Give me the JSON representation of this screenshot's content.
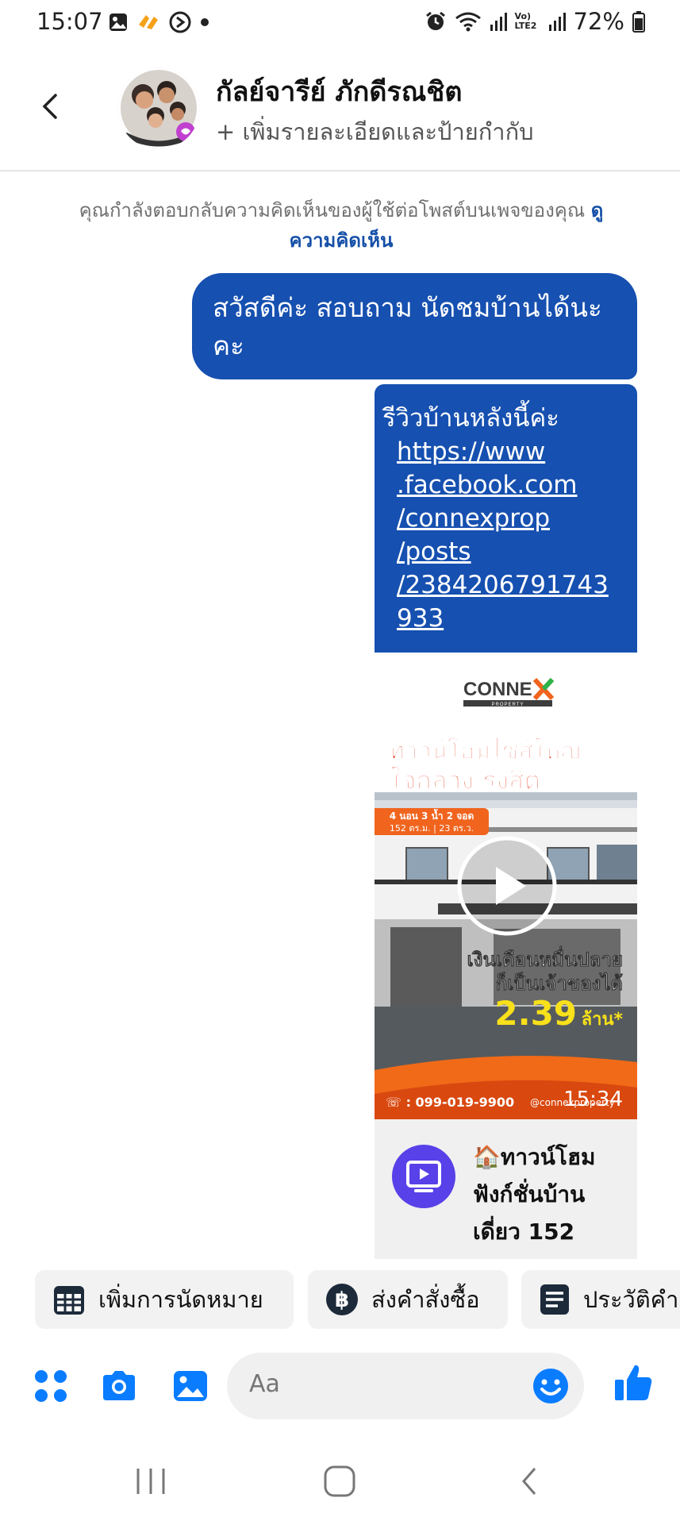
{
  "status_bar": {
    "time": "15:07",
    "left_icons": [
      "gallery-icon",
      "app-icon",
      "clock-icon",
      "dot-icon"
    ],
    "right_icons": [
      "alarm-icon",
      "wifi-icon",
      "signal-icon",
      "volte-icon",
      "signal-icon",
      "battery-icon"
    ],
    "volte_label": "Vo) LTE2",
    "battery": "72%"
  },
  "header": {
    "contact_name": "กัลย์จารีย์ ภักดีรณชิต",
    "contact_subtitle": "+ เพิ่มรายละเอียดและป้ายกำกับ"
  },
  "notice": {
    "text": "คุณกำลังตอบกลับความคิดเห็นของผู้ใช้ต่อโพสต์บนเพจของคุณ",
    "link": "ดูความคิดเห็น"
  },
  "messages": [
    {
      "text": "สวัสดีค่ะ สอบถาม นัดชมบ้านได้นะคะ"
    },
    {
      "text": "รีวิวบ้านหลังนี้ค่ะ",
      "link_lines": [
        "https://www",
        ".facebook.com",
        "/connexprop",
        "/posts",
        "/2384206791743",
        "933"
      ]
    }
  ],
  "link_preview": {
    "logo_text": "CONNEX",
    "logo_sub": "PROPERTY",
    "headline_line1": "ทาวน์โฮมไซส์ใหญ่",
    "headline_line2": "ใจกลาง รังสิต",
    "specs_line1": "4 นอน 3 น้ำ 2 จอด",
    "specs_line2": "152 ตร.ม. | 23 ตร.ว.",
    "caption_line1": "เงินเดือนหมื่นปลาย",
    "caption_line2": "ก็เป็นเจ้าของได้",
    "price": "2.39",
    "price_unit": "ล้าน*",
    "phone": "☏ : 099-019-9900",
    "handle": "@connexproperty",
    "duration": "15:34",
    "title_lines": [
      "🏠ทาวน์โฮม",
      "ฟังก์ชั่นบ้าน",
      "เดี่ยว 152"
    ]
  },
  "chips": [
    {
      "label": "เพิ่มการนัดหมาย",
      "icon": "calendar-icon"
    },
    {
      "label": "ส่งคำสั่งซื้อ",
      "icon": "baht-icon"
    },
    {
      "label": "ประวัติคำ",
      "icon": "receipt-icon"
    }
  ],
  "composer": {
    "placeholder": "Aa",
    "icons": [
      "apps-icon",
      "camera-icon",
      "gallery-icon",
      "emoji-icon",
      "thumbs-up-icon"
    ]
  },
  "colors": {
    "accent": "#1650b0",
    "link": "#1650a8",
    "icon_blue": "#0a7cff",
    "purple": "#5841e8"
  }
}
